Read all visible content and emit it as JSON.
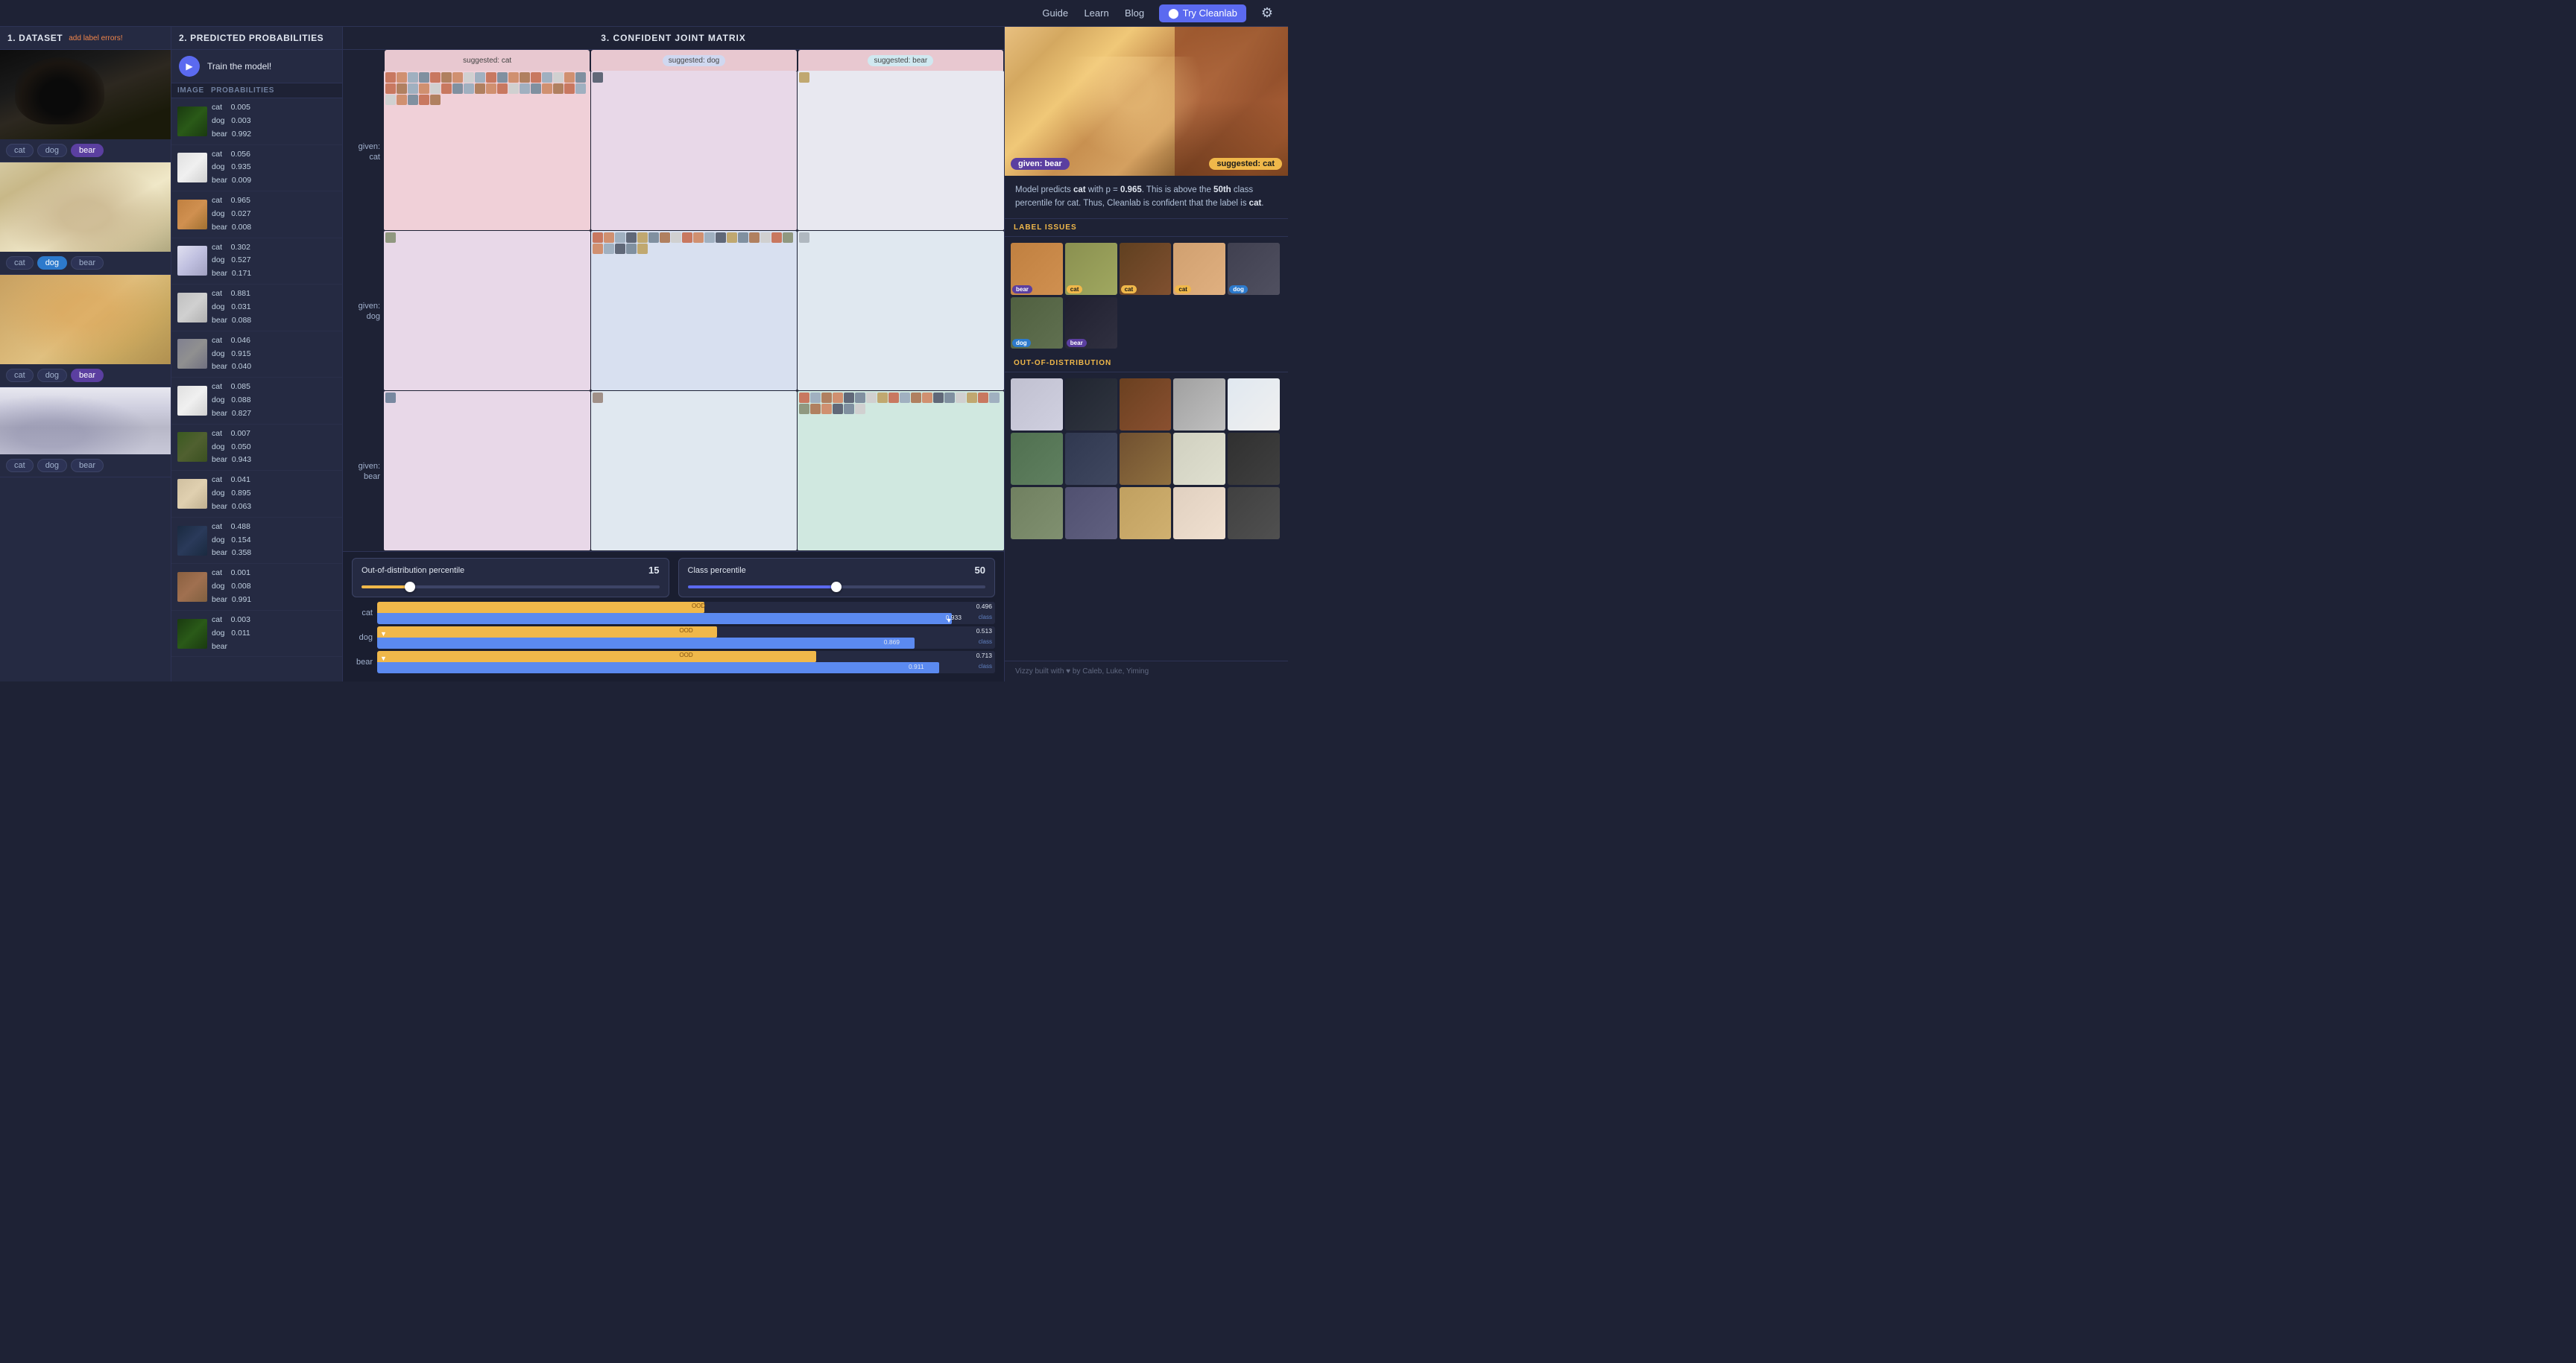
{
  "header": {
    "nav": [
      "Guide",
      "Learn",
      "Blog"
    ],
    "try_btn": "Try Cleanlab",
    "github_icon": "github"
  },
  "panel1": {
    "title": "1. DATASET",
    "subtitle": "add label errors!",
    "items": [
      {
        "imgClass": "img-bear1",
        "labels": [
          "cat",
          "dog",
          "bear"
        ],
        "active": "bear"
      },
      {
        "imgClass": "img-dog1",
        "labels": [
          "cat",
          "dog",
          "bear"
        ],
        "active": "dog"
      },
      {
        "imgClass": "img-cat1",
        "labels": [
          "cat",
          "dog",
          "bear"
        ],
        "active": "bear"
      },
      {
        "imgClass": "img-car1",
        "labels": [
          "cat",
          "dog",
          "bear"
        ],
        "active": null
      }
    ]
  },
  "panel2": {
    "title": "2. PREDICTED PROBABILITIES",
    "train_btn": "Train the model!",
    "col_image": "IMAGE",
    "col_probs": "PROBABILITIES",
    "rows": [
      {
        "imgClass": "pt1",
        "probs": [
          {
            "label": "cat",
            "val": "0.005"
          },
          {
            "label": "dog",
            "val": "0.003"
          },
          {
            "label": "bear",
            "val": "0.992"
          }
        ]
      },
      {
        "imgClass": "pt2",
        "probs": [
          {
            "label": "cat",
            "val": "0.056"
          },
          {
            "label": "dog",
            "val": "0.935"
          },
          {
            "label": "bear",
            "val": "0.009"
          }
        ]
      },
      {
        "imgClass": "pt3",
        "probs": [
          {
            "label": "cat",
            "val": "0.965"
          },
          {
            "label": "dog",
            "val": "0.027"
          },
          {
            "label": "bear",
            "val": "0.008"
          }
        ]
      },
      {
        "imgClass": "pt4",
        "probs": [
          {
            "label": "cat",
            "val": "0.302"
          },
          {
            "label": "dog",
            "val": "0.527"
          },
          {
            "label": "bear",
            "val": "0.171"
          }
        ]
      },
      {
        "imgClass": "pt5",
        "probs": [
          {
            "label": "cat",
            "val": "0.881"
          },
          {
            "label": "dog",
            "val": "0.031"
          },
          {
            "label": "bear",
            "val": "0.088"
          }
        ]
      },
      {
        "imgClass": "pt6",
        "probs": [
          {
            "label": "cat",
            "val": "0.046"
          },
          {
            "label": "dog",
            "val": "0.915"
          },
          {
            "label": "bear",
            "val": "0.040"
          }
        ]
      },
      {
        "imgClass": "pt2",
        "probs": [
          {
            "label": "cat",
            "val": "0.085"
          },
          {
            "label": "dog",
            "val": "0.088"
          },
          {
            "label": "bear",
            "val": "0.827"
          }
        ]
      },
      {
        "imgClass": "pt7",
        "probs": [
          {
            "label": "cat",
            "val": "0.007"
          },
          {
            "label": "dog",
            "val": "0.050"
          },
          {
            "label": "bear",
            "val": "0.943"
          }
        ]
      },
      {
        "imgClass": "pt8",
        "probs": [
          {
            "label": "cat",
            "val": "0.041"
          },
          {
            "label": "dog",
            "val": "0.895"
          },
          {
            "label": "bear",
            "val": "0.063"
          }
        ]
      },
      {
        "imgClass": "pt9",
        "probs": [
          {
            "label": "cat",
            "val": "0.488"
          },
          {
            "label": "dog",
            "val": "0.154"
          },
          {
            "label": "bear",
            "val": "0.358"
          }
        ]
      },
      {
        "imgClass": "pt10",
        "probs": [
          {
            "label": "cat",
            "val": "0.001"
          },
          {
            "label": "dog",
            "val": "0.008"
          },
          {
            "label": "bear",
            "val": "0.991"
          }
        ]
      },
      {
        "imgClass": "pt1",
        "probs": [
          {
            "label": "cat",
            "val": "0.003"
          },
          {
            "label": "dog",
            "val": "0.011"
          },
          {
            "label": "bear",
            "val": ""
          }
        ]
      }
    ]
  },
  "panel3": {
    "title": "3. CONFIDENT JOINT MATRIX",
    "col_headers": [
      {
        "label": "suggested: cat",
        "class": "cat-header"
      },
      {
        "label": "suggested: dog",
        "class": "dog-header"
      },
      {
        "label": "suggested: bear",
        "class": "bear-header"
      }
    ],
    "row_labels": [
      {
        "line1": "given:",
        "line2": "cat"
      },
      {
        "line1": "given:",
        "line2": "dog"
      },
      {
        "line1": "given:",
        "line2": "bear"
      }
    ]
  },
  "ood_section": {
    "ood_percentile_label": "Out-of-distribution percentile",
    "ood_percentile_value": 15,
    "class_percentile_label": "Class percentile",
    "class_percentile_value": 50,
    "bars": [
      {
        "label": "cat",
        "ood_val": "0.496",
        "class_val": "0.933",
        "ood_pct": 53,
        "class_pct": 93
      },
      {
        "label": "dog",
        "ood_val": "0.513",
        "class_val": "0.869",
        "ood_pct": 55,
        "class_pct": 87
      },
      {
        "label": "bear",
        "ood_val": "0.713",
        "class_val": "0.911",
        "ood_pct": 71,
        "class_pct": 91
      }
    ],
    "ood_text": "OOD",
    "class_text": "class"
  },
  "panel_right": {
    "given_label": "given: bear",
    "suggested_label": "suggested: cat",
    "prediction_text": "Model predicts",
    "prediction_bold": "cat",
    "prediction_p": "with p =",
    "prediction_p_val": "0.965",
    "prediction_tail": ". This is above the",
    "prediction_nth": "50th",
    "prediction_class": "class percentile for cat. Thus, Cleanlab is confident that the label is",
    "prediction_final": "cat",
    "label_issues_title": "LABEL ISSUES",
    "ood_title": "OUT-OF-DISTRIBUTION",
    "issue_items": [
      {
        "imgClass": "ith1",
        "tag": "bear",
        "tagClass": "tag-bear"
      },
      {
        "imgClass": "ith2",
        "tag": "cat",
        "tagClass": "tag-cat"
      },
      {
        "imgClass": "ith3",
        "tag": "cat",
        "tagClass": "tag-cat"
      },
      {
        "imgClass": "ith4",
        "tag": "cat",
        "tagClass": "tag-cat"
      },
      {
        "imgClass": "ith5",
        "tag": "dog",
        "tagClass": "tag-dog"
      },
      {
        "imgClass": "ith6",
        "tag": "dog",
        "tagClass": "tag-dog"
      },
      {
        "imgClass": "ith7",
        "tag": "bear",
        "tagClass": "tag-bear"
      }
    ],
    "ood_items": [
      "ood1",
      "ood2",
      "ood3",
      "ood4",
      "ood5",
      "ood6",
      "ood7",
      "ood8",
      "ood9",
      "ood10",
      "ood11",
      "ood12",
      "ood13",
      "ood14",
      "ood15"
    ],
    "footer": "Vizzy  built with ♥ by Caleb, Luke, Yiming"
  }
}
